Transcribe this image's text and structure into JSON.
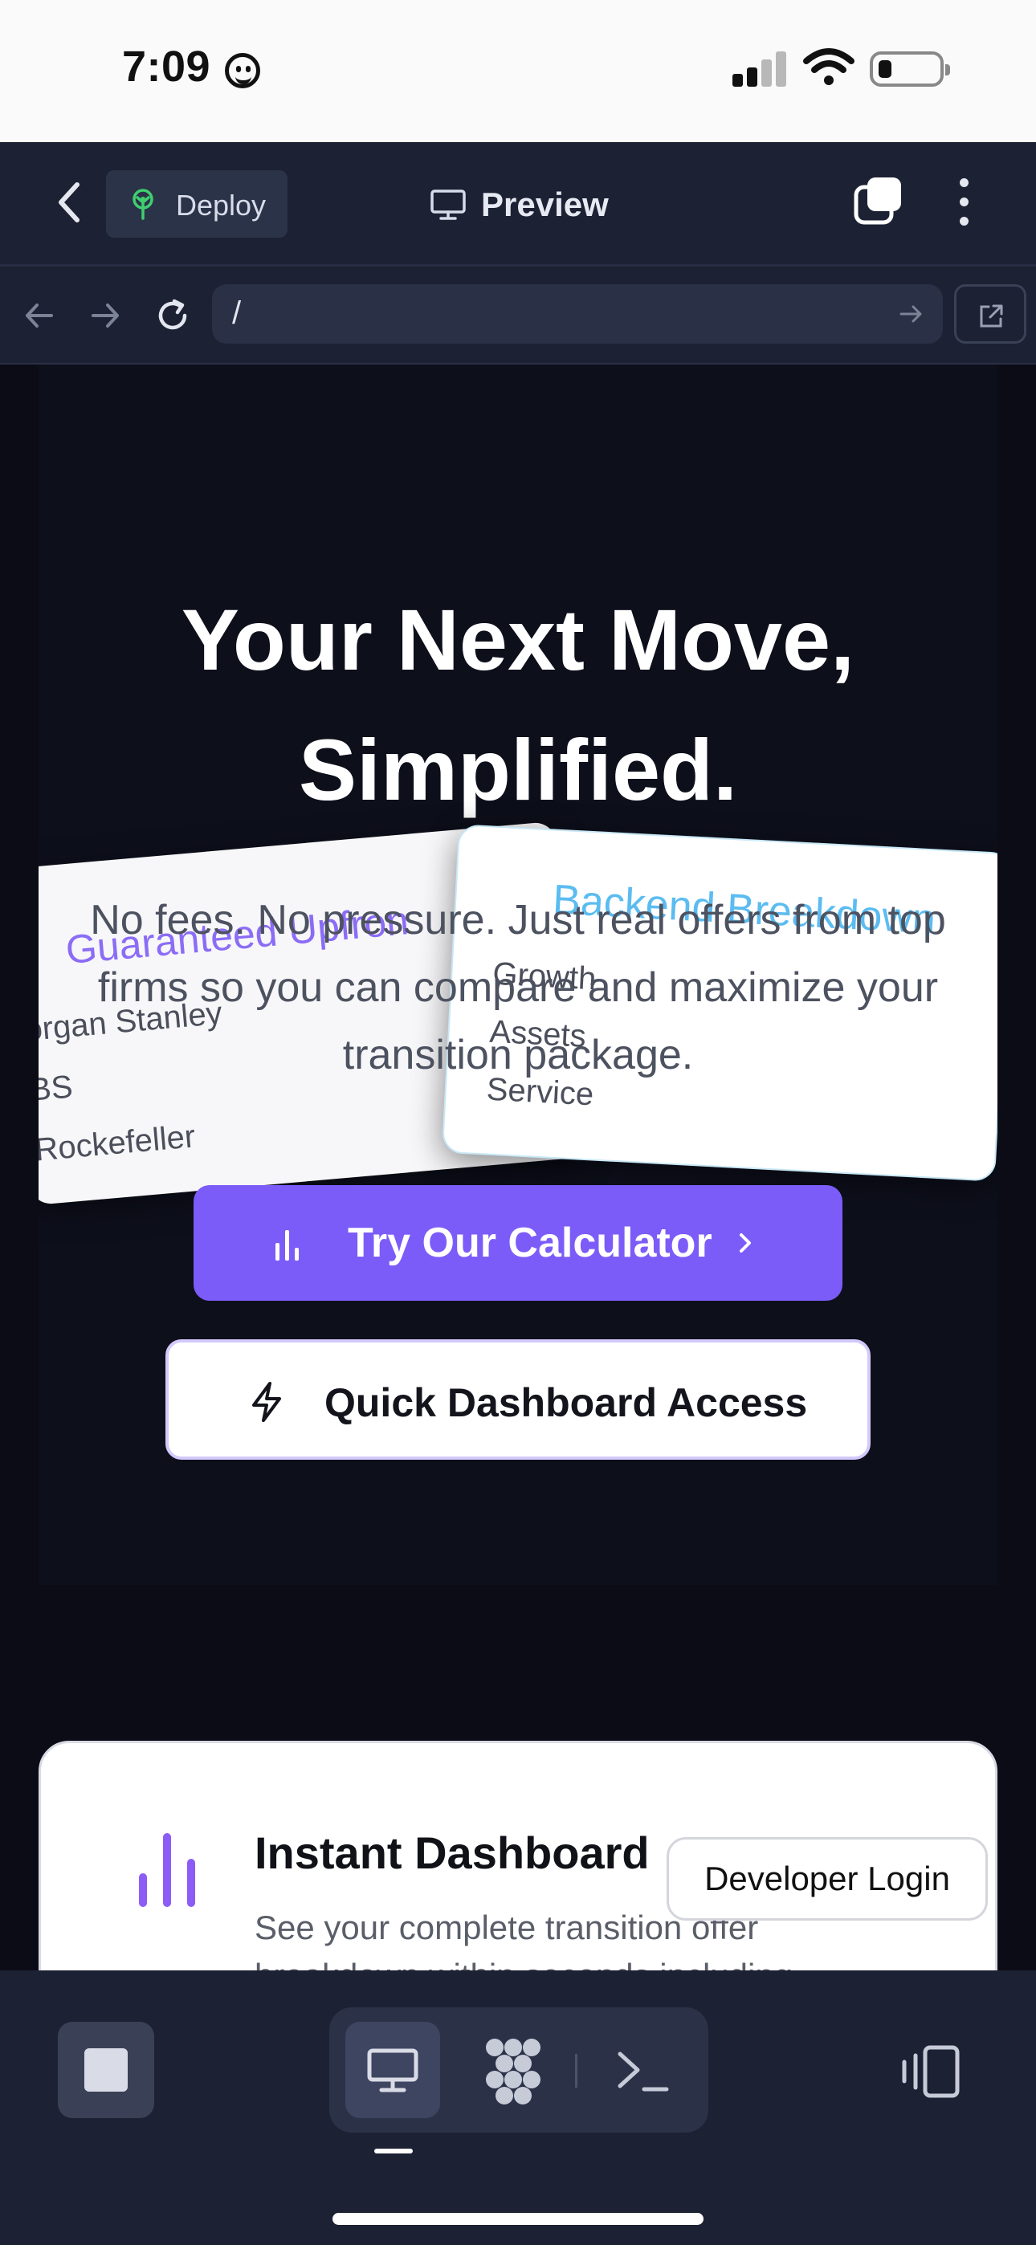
{
  "status_bar": {
    "time": "7:09",
    "emoji_icon": "smiley-face-icon",
    "signal_icon": "cellular-signal-icon",
    "wifi_icon": "wifi-icon",
    "battery_icon": "battery-low-icon"
  },
  "app_header": {
    "back_icon": "chevron-left-icon",
    "deploy_label": "Deploy",
    "deploy_icon": "deploy-tree-icon",
    "preview_label": "Preview",
    "preview_icon": "monitor-icon",
    "tabs_icon": "tabs-icon",
    "more_icon": "more-vertical-icon"
  },
  "browser_bar": {
    "url": "/",
    "back_icon": "arrow-left-icon",
    "forward_icon": "arrow-right-icon",
    "reload_icon": "reload-icon",
    "external_icon": "external-link-icon"
  },
  "hero": {
    "title_line1": "Your Next Move,",
    "title_line2": "Simplified.",
    "subtitle_line1": "No fees. No pressure. Just real offers from top",
    "subtitle_line2": "firms so you can compare and maximize your",
    "subtitle_line3": "transition package.",
    "card_left": {
      "title": "Guaranteed Upfron",
      "items": [
        "organ Stanley",
        "BS",
        "Rockefeller"
      ]
    },
    "card_right": {
      "title": "Backend Breakdown",
      "items": [
        "Growth",
        "Assets",
        "Service"
      ]
    },
    "calculator_button": "Try Our Calculator",
    "dashboard_button": "Quick Dashboard Access"
  },
  "feature": {
    "title": "Instant Dashboard",
    "description": "See your complete transition offer breakdown within seconds including"
  },
  "developer_login": "Developer Login",
  "colors": {
    "accent": "#7c5cf8",
    "card_left_title": "#8b6cf6",
    "card_right_title": "#5bbcf1",
    "header_bg": "#1c2133",
    "page_bg": "#0b0c16"
  }
}
